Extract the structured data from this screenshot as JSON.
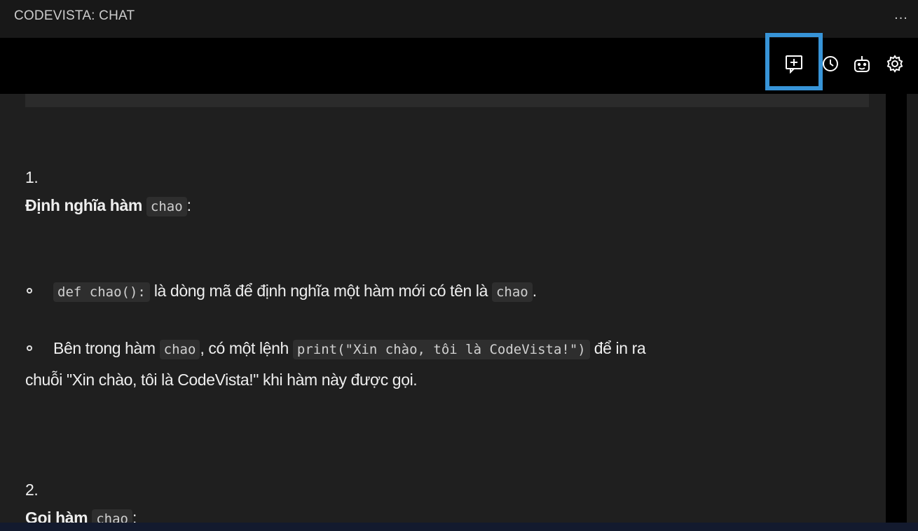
{
  "panel": {
    "title": "CODEVISTA: CHAT",
    "more_label": "..."
  },
  "toolbar": {
    "icons": [
      "new-chat-icon",
      "history-icon",
      "bot-icon",
      "settings-icon"
    ]
  },
  "message": {
    "item1": {
      "number": "1.",
      "heading": "Định nghĩa hàm",
      "heading_code": "chao",
      "heading_suffix": ":",
      "bullet1": {
        "code": "def chao():",
        "text": "là dòng mã để định nghĩa một hàm mới có tên là",
        "code2": "chao",
        "end": "."
      },
      "bullet2": {
        "prefix": "Bên trong hàm",
        "code": "chao",
        "mid": ", có một lệnh",
        "code2": "print(\"Xin chào, tôi là CodeVista!\")",
        "end": "để in ra",
        "line2": "chuỗi \"Xin chào, tôi là CodeVista!\" khi hàm này được gọi."
      }
    },
    "item2": {
      "number": "2.",
      "heading": "Gọi hàm",
      "heading_code": "chao",
      "heading_suffix": ":"
    }
  }
}
